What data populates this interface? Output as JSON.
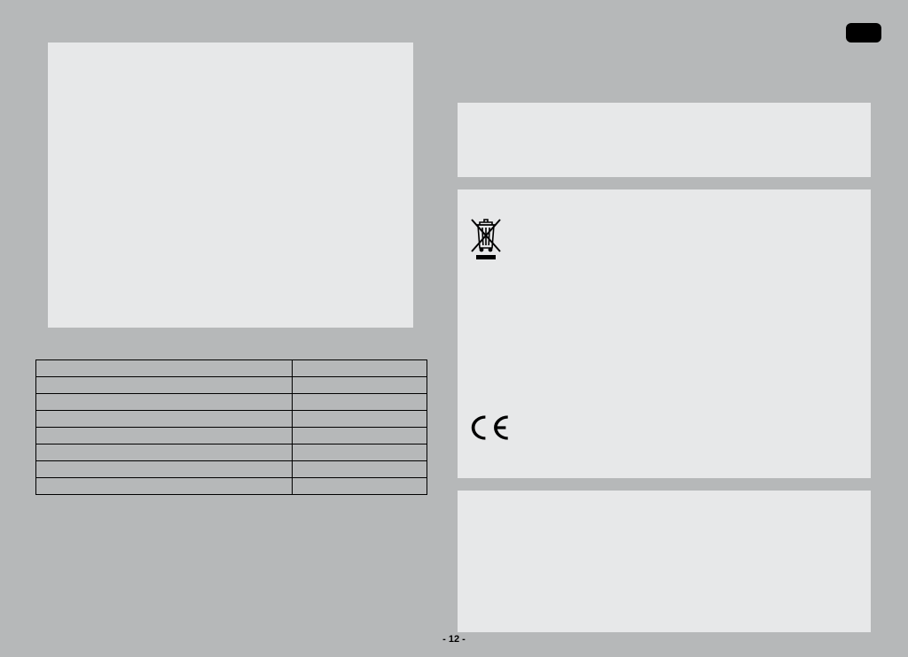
{
  "page_number": "- 12 -",
  "specs": {
    "rows": [
      {
        "label": "",
        "value": ""
      },
      {
        "label": "",
        "value": ""
      },
      {
        "label": "",
        "value": ""
      },
      {
        "label": "",
        "value": ""
      },
      {
        "label": "",
        "value": ""
      },
      {
        "label": "",
        "value": ""
      },
      {
        "label": "",
        "value": ""
      },
      {
        "label": "",
        "value": ""
      }
    ]
  },
  "icons": {
    "weee": "weee-bin-icon",
    "ce": "ce-mark-icon"
  }
}
